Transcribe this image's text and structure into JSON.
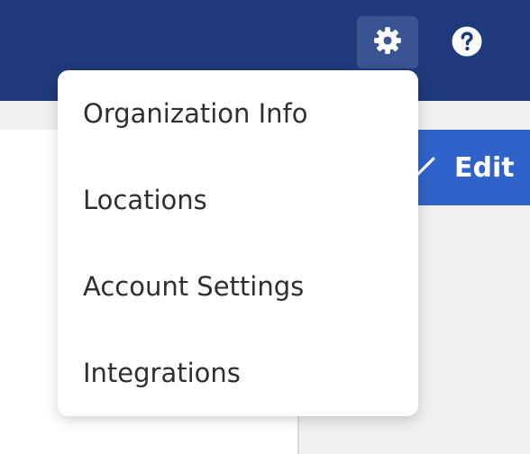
{
  "header": {
    "settings_icon": "gear-icon",
    "help_icon": "question-circle-icon",
    "background_color": "#1f3a7c"
  },
  "toolbar": {
    "edit_label": "Edit",
    "edit_icon": "pencil-icon"
  },
  "settings_menu": {
    "items": [
      {
        "label": "Organization Info"
      },
      {
        "label": "Locations"
      },
      {
        "label": "Account Settings"
      },
      {
        "label": "Integrations"
      }
    ]
  }
}
